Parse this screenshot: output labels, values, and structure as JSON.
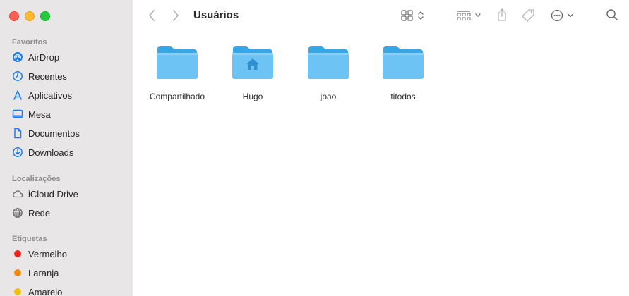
{
  "window": {
    "title": "Usuários"
  },
  "sidebar": {
    "sections": [
      {
        "title": "Favoritos",
        "items": [
          {
            "label": "AirDrop",
            "icon": "airdrop-icon"
          },
          {
            "label": "Recentes",
            "icon": "clock-icon"
          },
          {
            "label": "Aplicativos",
            "icon": "applications-icon"
          },
          {
            "label": "Mesa",
            "icon": "desktop-icon"
          },
          {
            "label": "Documentos",
            "icon": "document-icon"
          },
          {
            "label": "Downloads",
            "icon": "download-icon"
          }
        ]
      },
      {
        "title": "Localizações",
        "items": [
          {
            "label": "iCloud Drive",
            "icon": "cloud-icon"
          },
          {
            "label": "Rede",
            "icon": "network-icon"
          }
        ]
      },
      {
        "title": "Etiquetas",
        "items": [
          {
            "label": "Vermelho",
            "color": "#f0201c"
          },
          {
            "label": "Laranja",
            "color": "#f08a10"
          },
          {
            "label": "Amarelo",
            "color": "#f2c012"
          }
        ]
      }
    ]
  },
  "folders": [
    {
      "name": "Compartilhado"
    },
    {
      "name": "Hugo"
    },
    {
      "name": "joao"
    },
    {
      "name": "titodos"
    }
  ],
  "colors": {
    "accent": "#1a7cf0",
    "folder": "#6cc3f4"
  }
}
